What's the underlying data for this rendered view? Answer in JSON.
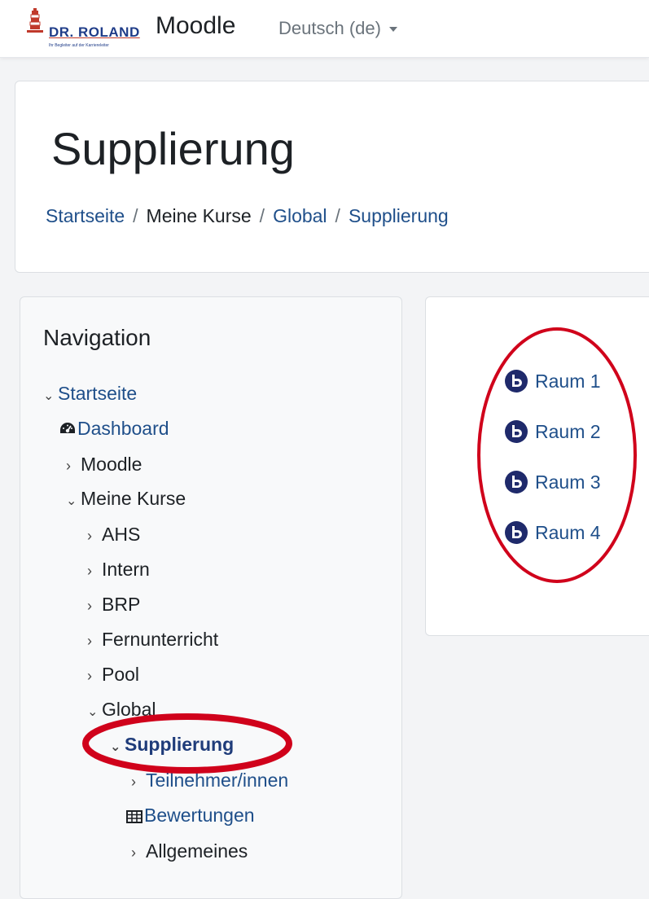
{
  "navbar": {
    "brand_name": "DR. ROLAND",
    "brand_tagline": "Ihr Begleiter auf der Karriereleiter",
    "site_name": "Moodle",
    "language": "Deutsch (de)"
  },
  "header": {
    "title": "Supplierung",
    "breadcrumb": [
      "Startseite",
      "Meine Kurse",
      "Global",
      "Supplierung"
    ],
    "breadcrumb_sep": "/"
  },
  "navigation": {
    "title": "Navigation",
    "items": [
      {
        "label": "Startseite",
        "expanded": true
      },
      {
        "label": "Dashboard",
        "icon": "dashboard-icon"
      },
      {
        "label": "Moodle",
        "expanded": false
      },
      {
        "label": "Meine Kurse",
        "expanded": true
      },
      {
        "label": "AHS",
        "expanded": false
      },
      {
        "label": "Intern",
        "expanded": false
      },
      {
        "label": "BRP",
        "expanded": false
      },
      {
        "label": "Fernunterricht",
        "expanded": false
      },
      {
        "label": "Pool",
        "expanded": false
      },
      {
        "label": "Global",
        "expanded": true
      },
      {
        "label": "Supplierung",
        "expanded": true,
        "active": true
      },
      {
        "label": "Teilnehmer/innen",
        "expanded": false
      },
      {
        "label": "Bewertungen",
        "icon": "table-icon"
      },
      {
        "label": "Allgemeines",
        "expanded": false
      }
    ]
  },
  "content": {
    "rooms": [
      {
        "label": "Raum 1",
        "icon": "bigbluebutton-icon"
      },
      {
        "label": "Raum 2",
        "icon": "bigbluebutton-icon"
      },
      {
        "label": "Raum 3",
        "icon": "bigbluebutton-icon"
      },
      {
        "label": "Raum 4",
        "icon": "bigbluebutton-icon"
      }
    ]
  },
  "colors": {
    "link": "#1f4f8a",
    "brand": "#1f3c88",
    "annotation": "#d0021b",
    "bbb_icon": "#1f2a6b"
  }
}
